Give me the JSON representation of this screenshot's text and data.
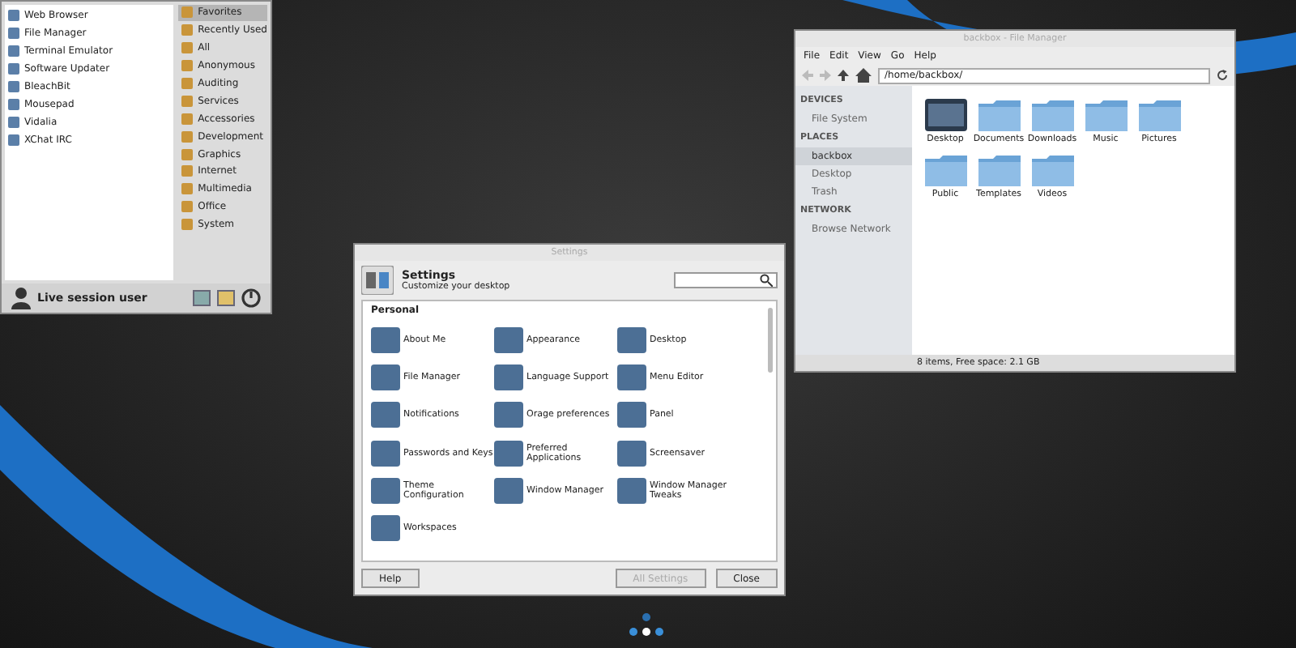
{
  "app_menu": {
    "applications": [
      {
        "label": "Web Browser"
      },
      {
        "label": "File Manager"
      },
      {
        "label": "Terminal Emulator"
      },
      {
        "label": "Software Updater"
      },
      {
        "label": "BleachBit"
      },
      {
        "label": "Mousepad"
      },
      {
        "label": "Vidalia"
      },
      {
        "label": "XChat IRC"
      }
    ],
    "categories": [
      {
        "label": "Favorites",
        "selected": true
      },
      {
        "label": "Recently Used",
        "selected": false
      },
      {
        "label": "All",
        "selected": false
      },
      {
        "label": "Anonymous",
        "selected": false
      },
      {
        "label": "Auditing",
        "selected": false
      },
      {
        "label": "Services",
        "selected": false
      },
      {
        "label": "Accessories",
        "selected": false
      },
      {
        "label": "Development",
        "selected": false
      },
      {
        "label": "Graphics",
        "selected": false
      },
      {
        "label": "Internet",
        "selected": false
      },
      {
        "label": "Multimedia",
        "selected": false
      },
      {
        "label": "Office",
        "selected": false
      },
      {
        "label": "System",
        "selected": false
      }
    ],
    "user": "Live session user"
  },
  "file_manager": {
    "title": "backbox - File Manager",
    "menu": [
      "File",
      "Edit",
      "View",
      "Go",
      "Help"
    ],
    "path": "/home/backbox/",
    "sidebar": [
      {
        "heading": "DEVICES",
        "items": [
          {
            "label": "File System",
            "selected": false
          }
        ]
      },
      {
        "heading": "PLACES",
        "items": [
          {
            "label": "backbox",
            "selected": true
          },
          {
            "label": "Desktop",
            "selected": false
          },
          {
            "label": "Trash",
            "selected": false
          }
        ]
      },
      {
        "heading": "NETWORK",
        "items": [
          {
            "label": "Browse Network",
            "selected": false
          }
        ]
      }
    ],
    "files": [
      {
        "name": "Desktop",
        "kind": "screen"
      },
      {
        "name": "Documents",
        "kind": "folder"
      },
      {
        "name": "Downloads",
        "kind": "folder"
      },
      {
        "name": "Music",
        "kind": "folder"
      },
      {
        "name": "Pictures",
        "kind": "folder"
      },
      {
        "name": "Public",
        "kind": "folder"
      },
      {
        "name": "Templates",
        "kind": "folder"
      },
      {
        "name": "Videos",
        "kind": "folder"
      }
    ],
    "status": "8 items, Free space: 2.1 GB"
  },
  "settings": {
    "title": "Settings",
    "heading": "Settings",
    "subheading": "Customize your desktop",
    "section": "Personal",
    "items": [
      {
        "label": "About Me"
      },
      {
        "label": "Appearance"
      },
      {
        "label": "Desktop"
      },
      {
        "label": "File Manager"
      },
      {
        "label": "Language Support"
      },
      {
        "label": "Menu Editor"
      },
      {
        "label": "Notifications"
      },
      {
        "label": "Orage preferences"
      },
      {
        "label": "Panel"
      },
      {
        "label": "Passwords and Keys"
      },
      {
        "label": "Preferred Applications"
      },
      {
        "label": "Screensaver"
      },
      {
        "label": "Theme Configuration"
      },
      {
        "label": "Window Manager"
      },
      {
        "label": "Window Manager Tweaks"
      },
      {
        "label": "Workspaces"
      }
    ],
    "buttons": [
      {
        "label": "Help",
        "disabled": false
      },
      {
        "label": "All Settings",
        "disabled": true
      },
      {
        "label": "Close",
        "disabled": false
      }
    ]
  }
}
